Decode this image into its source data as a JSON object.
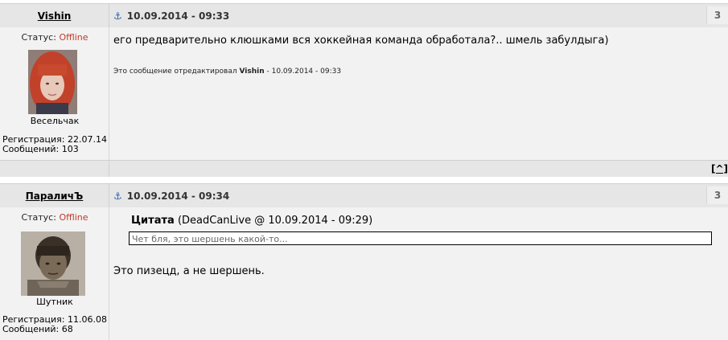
{
  "posts": [
    {
      "author": "Vishin",
      "date": "10.09.2014 - 09:33",
      "post_number": "3",
      "status_label": "Статус:",
      "status_value": "Offline",
      "rank": "Весельчак",
      "reg_label": "Регистрация:",
      "reg_value": "22.07.14",
      "msgs_label": "Сообщений:",
      "msgs_value": "103",
      "text": "его предварительно клюшками вся хоккейная команда обработала?.. шмель забулдыга)",
      "edit_prefix": "Это сообщение отредактировал",
      "edit_author": "Vishin",
      "edit_suffix": "- 10.09.2014 - 09:33",
      "up_link": "[^]"
    },
    {
      "author": "ПараличЪ",
      "date": "10.09.2014 - 09:34",
      "post_number": "3",
      "status_label": "Статус:",
      "status_value": "Offline",
      "rank": "Шутник",
      "reg_label": "Регистрация:",
      "reg_value": "11.06.08",
      "msgs_label": "Сообщений:",
      "msgs_value": "68",
      "quote_label": "Цитата",
      "quote_meta": "(DeadCanLive @ 10.09.2014 - 09:29)",
      "quote_text": "Чет бля, это шершень какой-то...",
      "text": "Это пизецд, а не шершень."
    }
  ],
  "colors": {
    "offline": "#c0392b",
    "anchor": "#2a5ea8",
    "header_bg": "#e6e6e6",
    "body_bg": "#f2f2f2"
  },
  "icons": {
    "anchor": "anchor-icon"
  }
}
